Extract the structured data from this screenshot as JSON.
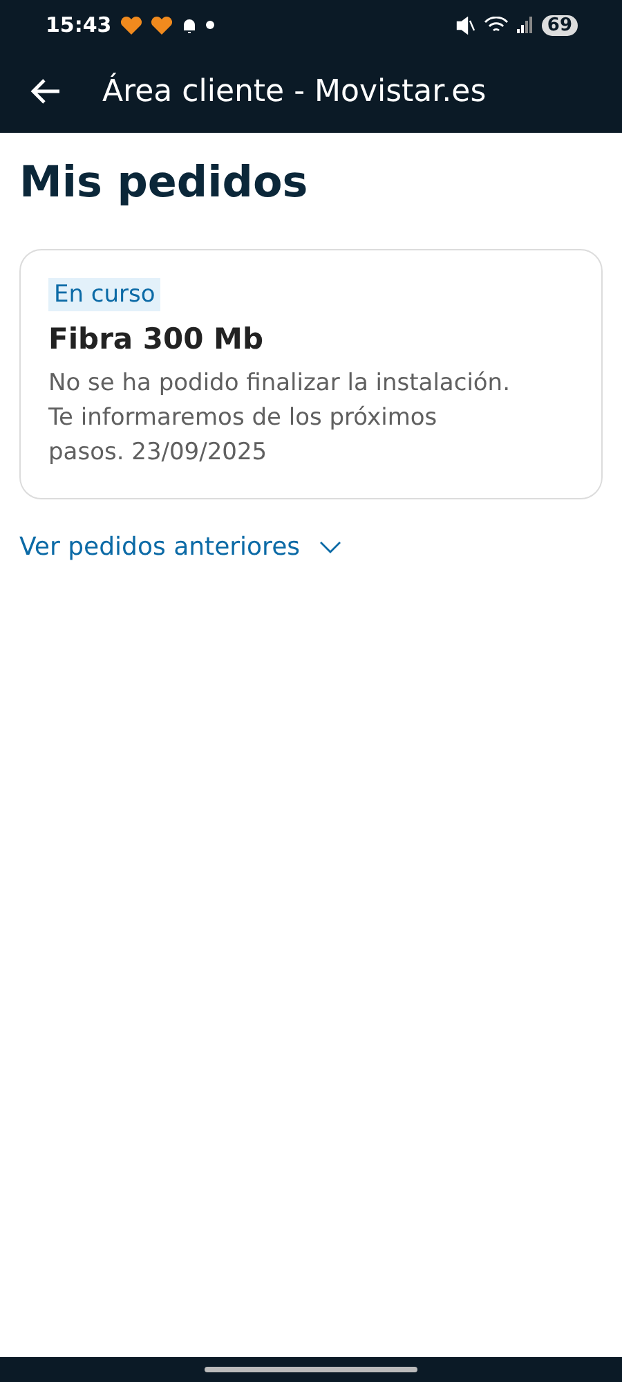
{
  "status_bar": {
    "time": "15:43",
    "battery": "69"
  },
  "app_bar": {
    "title": "Área cliente - Movistar.es"
  },
  "page_title": "Mis pedidos",
  "orders": [
    {
      "status": "En curso",
      "title": "Fibra 300 Mb",
      "description": "No se ha podido finalizar la instalación. Te informaremos de los próximos pasos. 23/09/2025"
    }
  ],
  "more_link": {
    "label": "Ver pedidos anteriores",
    "expanded": false
  }
}
